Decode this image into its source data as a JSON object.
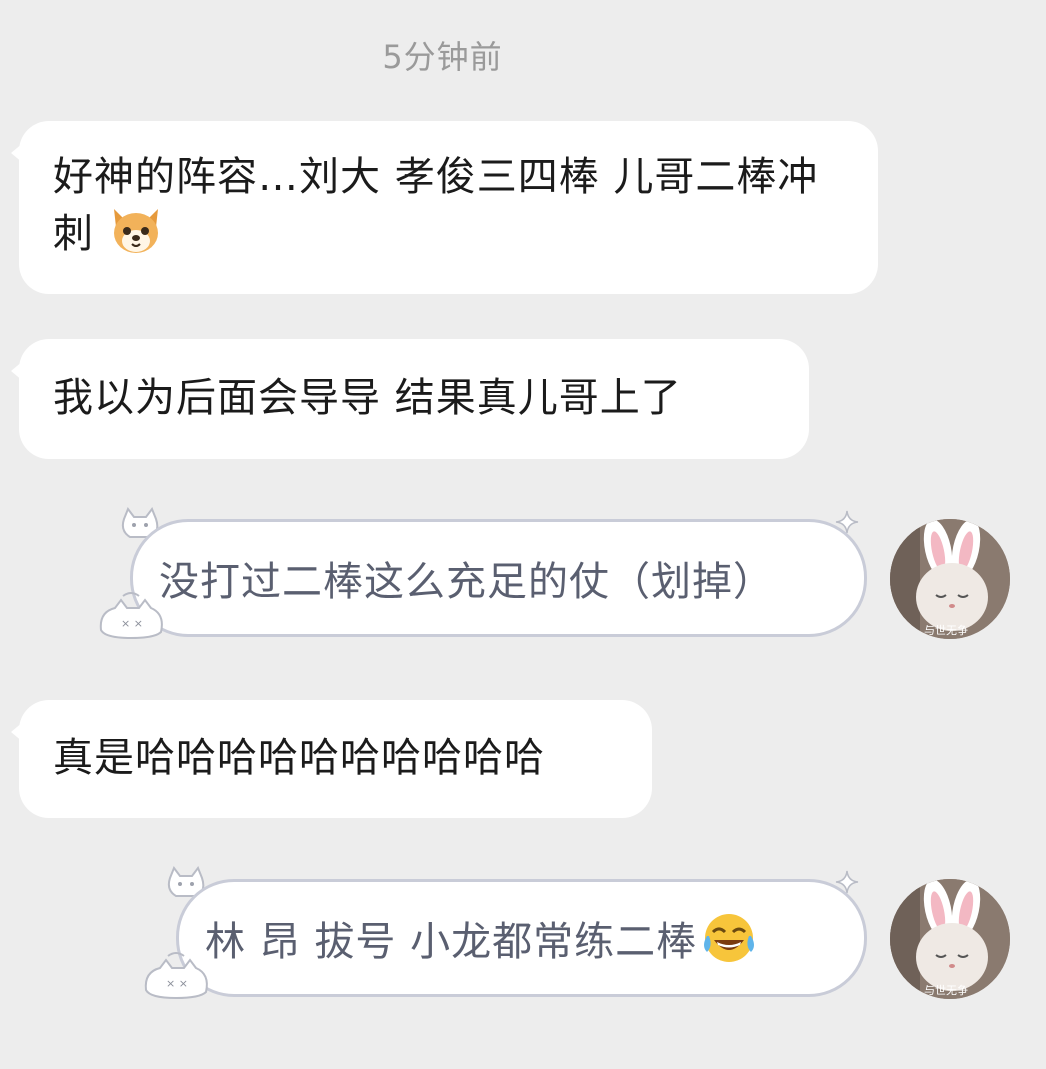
{
  "timestamp": "5分钟前",
  "messages": [
    {
      "id": "m1",
      "side": "left",
      "text": "好神的阵容…刘大 孝俊三四棒 儿哥二棒冲刺",
      "emoji": "dog-face-emoji"
    },
    {
      "id": "m2",
      "side": "left",
      "text": "我以为后面会导导 结果真儿哥上了"
    },
    {
      "id": "m3",
      "side": "right",
      "text": "没打过二棒这么充足的仗（划掉）",
      "avatar_caption": "与世无争"
    },
    {
      "id": "m4",
      "side": "left",
      "text": "真是哈哈哈哈哈哈哈哈哈哈"
    },
    {
      "id": "m5",
      "side": "right",
      "text": "林 昂 拔号 小龙都常练二棒",
      "emoji": "tears-of-joy-emoji",
      "avatar_caption": "与世无争"
    }
  ],
  "colors": {
    "background": "#ededed",
    "left_bubble": "#ffffff",
    "right_bubble_border": "#c9ccd8",
    "right_text": "#5a5f70"
  }
}
